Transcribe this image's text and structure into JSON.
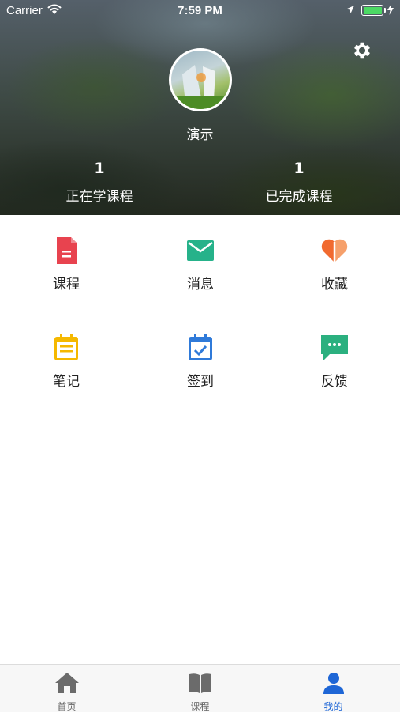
{
  "status_bar": {
    "carrier": "Carrier",
    "time": "7:59 PM"
  },
  "profile": {
    "name": "演示"
  },
  "stats": [
    {
      "value": "1",
      "label": "正在学课程"
    },
    {
      "value": "1",
      "label": "已完成课程"
    }
  ],
  "menu": [
    {
      "label": "课程",
      "icon": "document-icon",
      "color": "#e8434f"
    },
    {
      "label": "消息",
      "icon": "mail-icon",
      "color": "#26b28a"
    },
    {
      "label": "收藏",
      "icon": "heart-icon",
      "color": "#f16a2f"
    },
    {
      "label": "笔记",
      "icon": "notepad-icon",
      "color": "#f5b800"
    },
    {
      "label": "签到",
      "icon": "calendar-check-icon",
      "color": "#2f7ad9"
    },
    {
      "label": "反馈",
      "icon": "chat-bubble-icon",
      "color": "#2bb07f"
    }
  ],
  "tabs": [
    {
      "label": "首页",
      "icon": "home-icon"
    },
    {
      "label": "课程",
      "icon": "book-icon"
    },
    {
      "label": "我的",
      "icon": "user-icon",
      "active": true
    }
  ],
  "colors": {
    "active_tab": "#1e66d6",
    "inactive_tab": "#666666"
  }
}
